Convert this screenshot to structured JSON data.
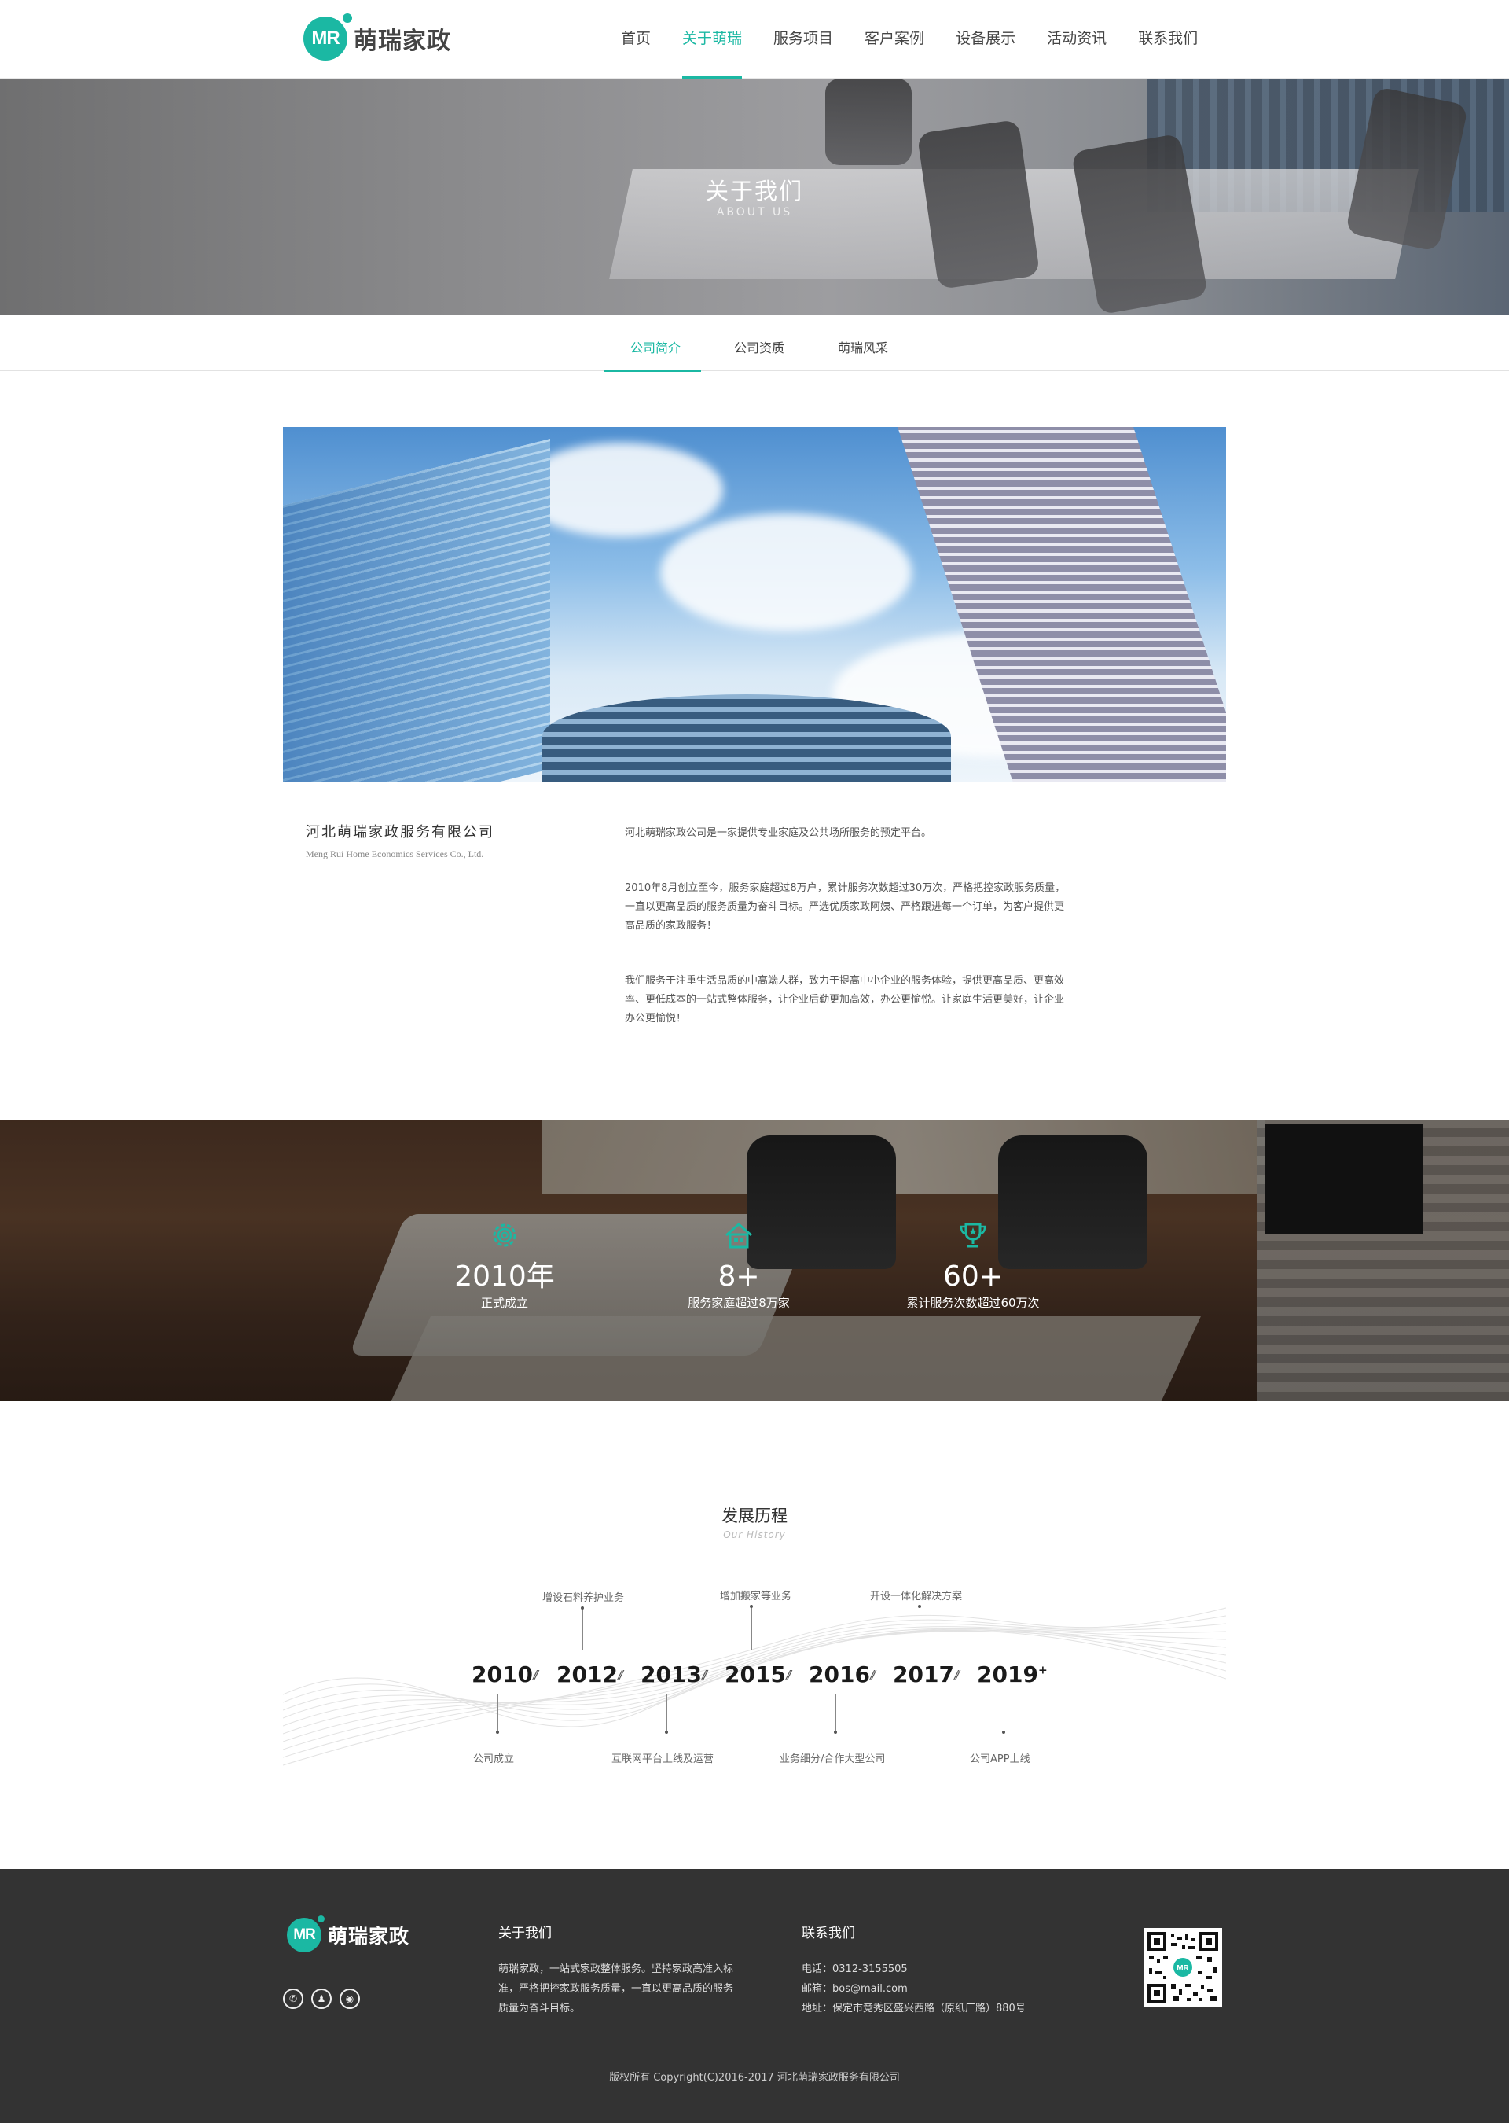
{
  "brand": {
    "logo_initials": "MR",
    "name": "萌瑞家政",
    "accent_color": "#1bb8a3"
  },
  "nav": {
    "items": [
      {
        "label": "首页"
      },
      {
        "label": "关于萌瑞",
        "active": true
      },
      {
        "label": "服务项目"
      },
      {
        "label": "客户案例"
      },
      {
        "label": "设备展示"
      },
      {
        "label": "活动资讯"
      },
      {
        "label": "联系我们"
      }
    ]
  },
  "banner": {
    "title": "关于我们",
    "subtitle": "ABOUT  US"
  },
  "subtabs": [
    {
      "label": "公司简介",
      "active": true
    },
    {
      "label": "公司资质"
    },
    {
      "label": "萌瑞风采"
    }
  ],
  "company": {
    "name": "河北萌瑞家政服务有限公司",
    "name_en": "Meng Rui Home Economics Services Co., Ltd.",
    "paragraphs": [
      "河北萌瑞家政公司是一家提供专业家庭及公共场所服务的预定平台。",
      "2010年8月创立至今，服务家庭超过8万户，累计服务次数超过30万次，严格把控家政服务质量，一直以更高品质的服务质量为奋斗目标。严选优质家政阿姨、严格跟进每一个订单，为客户提供更高品质的家政服务！",
      "我们服务于注重生活品质的中高端人群，致力于提高中小企业的服务体验，提供更高品质、更高效率、更低成本的一站式整体服务，让企业后勤更加高效，办公更愉悦。让家庭生活更美好，让企业办公更愉悦！"
    ]
  },
  "stats": [
    {
      "icon": "gear-icon",
      "value": "2010年",
      "label": "正式成立"
    },
    {
      "icon": "house-icon",
      "value": "8+",
      "label": "服务家庭超过8万家"
    },
    {
      "icon": "trophy-icon",
      "value": "60+",
      "label": "累计服务次数超过60万次"
    }
  ],
  "history": {
    "title": "发展历程",
    "subtitle": "Our  History",
    "years": [
      "2010",
      "2012",
      "2013",
      "2015",
      "2016",
      "2017",
      "2019"
    ],
    "year_suffix": "+",
    "events_above": [
      {
        "year": "2012",
        "text": "增设石料养护业务"
      },
      {
        "year": "2015",
        "text": "增加搬家等业务"
      },
      {
        "year": "2017",
        "text": "开设一体化解决方案"
      }
    ],
    "events_below": [
      {
        "year": "2010",
        "text": "公司成立"
      },
      {
        "year": "2013",
        "text": "互联网平台上线及运营"
      },
      {
        "year": "2016",
        "text": "业务细分/合作大型公司"
      },
      {
        "year": "2019",
        "text": "公司APP上线"
      }
    ]
  },
  "footer": {
    "about_title": "关于我们",
    "about_text": "萌瑞家政，一站式家政整体服务。坚持家政高准入标准，严格把控家政服务质量，一直以更高品质的服务质量为奋斗目标。",
    "contact_title": "联系我们",
    "phone": "电话：0312-3155505",
    "email": "邮箱：bos@mail.com",
    "address": "地址：保定市竞秀区盛兴西路（原纸厂路）880号",
    "social": [
      {
        "icon": "wechat-icon",
        "glyph": "✆"
      },
      {
        "icon": "qq-icon",
        "glyph": "♟"
      },
      {
        "icon": "weibo-icon",
        "glyph": "◉"
      }
    ],
    "copyright": "版权所有 Copyright(C)2016-2017 河北萌瑞家政服务有限公司"
  }
}
